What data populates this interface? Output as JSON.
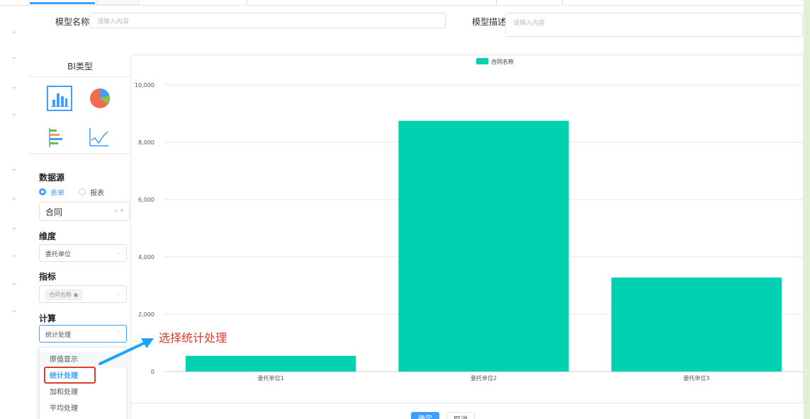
{
  "form": {
    "model_name_label": "模型名称",
    "model_name_placeholder": "请输入内容",
    "model_desc_label": "模型描述",
    "model_desc_placeholder": "请输入内容"
  },
  "sidebar": {
    "bi_type_title": "BI类型",
    "chart_types": [
      "bar-chart-icon",
      "pie-chart-icon",
      "horizontal-bar-chart-icon",
      "line-chart-icon"
    ],
    "selected_chart_type": "bar-chart-icon",
    "datasource_label": "数据源",
    "datasource_options": [
      "表单",
      "报表"
    ],
    "datasource_selected": "表单",
    "datasource_value": "合同",
    "dimension_label": "维度",
    "dimension_value": "委托单位",
    "metric_label": "指标",
    "metric_tag": "合同名称",
    "calc_label": "计算",
    "calc_value": "统计处理",
    "calc_options": [
      "原值显示",
      "统计处理",
      "加和处理",
      "平均处理"
    ],
    "calc_selected": "统计处理"
  },
  "annotation": {
    "text": "选择统计处理",
    "color": "#e03b2b"
  },
  "colors": {
    "accent": "#409eff",
    "bar": "#00d1b0",
    "edge": "#dff0d8"
  },
  "chart_data": {
    "type": "bar",
    "categories": [
      "委托单位1",
      "委托单位2",
      "委托单位3"
    ],
    "series": [
      {
        "name": "合同名称",
        "values": [
          550,
          8750,
          3280
        ]
      }
    ],
    "yticks": [
      "0",
      "2,000",
      "4,000",
      "6,000",
      "8,000",
      "10,000"
    ],
    "ylim": [
      0,
      10000
    ],
    "legend": "top-center",
    "grid": true
  },
  "buttons": {
    "confirm": "确定",
    "cancel": "取消"
  }
}
